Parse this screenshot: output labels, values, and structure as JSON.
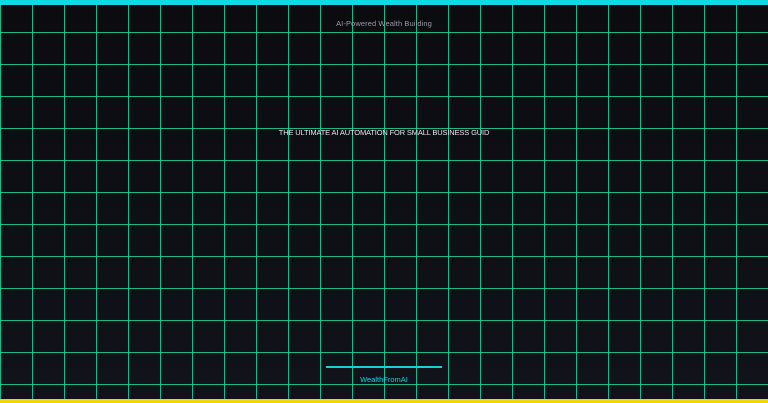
{
  "tagline": "AI-Powered Wealth Building",
  "headline": "THE ULTIMATE AI AUTOMATION FOR SMALL BUSINESS GUID",
  "brand": "WealthFromAI",
  "colors": {
    "background": "#0d0d12",
    "grid_line": "#1fd6a0",
    "top_bar": "#10d8e0",
    "bottom_bar": "#f2d40a",
    "accent": "#14d2dc"
  }
}
